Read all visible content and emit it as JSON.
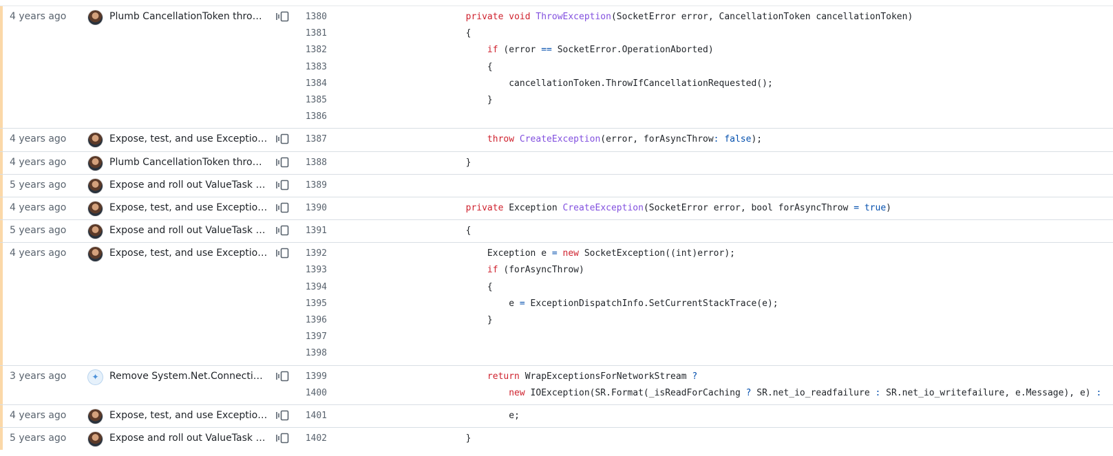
{
  "hunks": [
    {
      "age": "4 years ago",
      "avatar": "user-avatar",
      "message": "Plumb CancellationToken throug...",
      "lines": [
        {
          "num": "1380",
          "code": "        private void ThrowException(SocketError error, CancellationToken cancellationToken)"
        },
        {
          "num": "1381",
          "code": "        {"
        },
        {
          "num": "1382",
          "code": "            if (error == SocketError.OperationAborted)"
        },
        {
          "num": "1383",
          "code": "            {"
        },
        {
          "num": "1384",
          "code": "                cancellationToken.ThrowIfCancellationRequested();"
        },
        {
          "num": "1385",
          "code": "            }"
        },
        {
          "num": "1386",
          "code": ""
        }
      ]
    },
    {
      "age": "4 years ago",
      "avatar": "user-avatar",
      "message": "Expose, test, and use ExceptionD...",
      "lines": [
        {
          "num": "1387",
          "code": "            throw CreateException(error, forAsyncThrow: false);"
        }
      ]
    },
    {
      "age": "4 years ago",
      "avatar": "user-avatar",
      "message": "Plumb CancellationToken throug...",
      "lines": [
        {
          "num": "1388",
          "code": "        }"
        }
      ]
    },
    {
      "age": "5 years ago",
      "avatar": "user-avatar",
      "message": "Expose and roll out ValueTask ex...",
      "lines": [
        {
          "num": "1389",
          "code": ""
        }
      ]
    },
    {
      "age": "4 years ago",
      "avatar": "user-avatar",
      "message": "Expose, test, and use ExceptionD...",
      "lines": [
        {
          "num": "1390",
          "code": "        private Exception CreateException(SocketError error, bool forAsyncThrow = true)"
        }
      ]
    },
    {
      "age": "5 years ago",
      "avatar": "user-avatar",
      "message": "Expose and roll out ValueTask ex...",
      "lines": [
        {
          "num": "1391",
          "code": "        {"
        }
      ]
    },
    {
      "age": "4 years ago",
      "avatar": "user-avatar",
      "message": "Expose, test, and use ExceptionD...",
      "lines": [
        {
          "num": "1392",
          "code": "            Exception e = new SocketException((int)error);"
        },
        {
          "num": "1393",
          "code": "            if (forAsyncThrow)"
        },
        {
          "num": "1394",
          "code": "            {"
        },
        {
          "num": "1395",
          "code": "                e = ExceptionDispatchInfo.SetCurrentStackTrace(e);"
        },
        {
          "num": "1396",
          "code": "            }"
        },
        {
          "num": "1397",
          "code": ""
        },
        {
          "num": "1398",
          "code": ""
        }
      ]
    },
    {
      "age": "3 years ago",
      "avatar": "bot-avatar",
      "message": "Remove System.Net.Connection...",
      "lines": [
        {
          "num": "1399",
          "code": "            return WrapExceptionsForNetworkStream ?"
        },
        {
          "num": "1400",
          "code": "                new IOException(SR.Format(_isReadForCaching ? SR.net_io_readfailure : SR.net_io_writefailure, e.Message), e) :"
        }
      ]
    },
    {
      "age": "4 years ago",
      "avatar": "user-avatar",
      "message": "Expose, test, and use ExceptionD...",
      "lines": [
        {
          "num": "1401",
          "code": "                e;"
        }
      ]
    },
    {
      "age": "5 years ago",
      "avatar": "user-avatar",
      "message": "Expose and roll out ValueTask ex...",
      "lines": [
        {
          "num": "1402",
          "code": "        }"
        }
      ]
    }
  ],
  "icons": {
    "reblame": "reblame-icon"
  },
  "colors": {
    "age_bar": "#fbd8a8",
    "keyword": "#cf222e",
    "function": "#8250df",
    "operator": "#0550ae",
    "line_number": "#59636e"
  }
}
